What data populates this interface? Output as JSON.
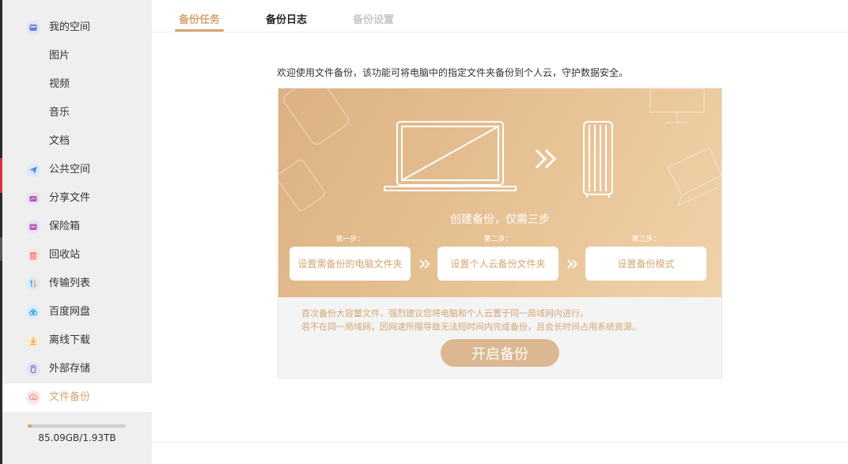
{
  "sidebar": {
    "items": [
      {
        "label": "我的空间",
        "icon": "my-space-icon",
        "color": "#6b7fd7"
      },
      {
        "label": "图片",
        "icon": ""
      },
      {
        "label": "视频",
        "icon": ""
      },
      {
        "label": "音乐",
        "icon": ""
      },
      {
        "label": "文档",
        "icon": ""
      },
      {
        "label": "公共空间",
        "icon": "paper-plane-icon",
        "color": "#4a90e2"
      },
      {
        "label": "分享文件",
        "icon": "share-icon",
        "color": "#9b59d6"
      },
      {
        "label": "保险箱",
        "icon": "safe-icon",
        "color": "#b05ad6"
      },
      {
        "label": "回收站",
        "icon": "trash-icon",
        "color": "#f06a5a"
      },
      {
        "label": "传输列表",
        "icon": "transfer-icon",
        "color": "#3aa3e3"
      },
      {
        "label": "百度网盘",
        "icon": "cloud-icon",
        "color": "#3aa3e3"
      },
      {
        "label": "离线下载",
        "icon": "download-icon",
        "color": "#f0a24a"
      },
      {
        "label": "外部存储",
        "icon": "usb-icon",
        "color": "#8e6ad6"
      },
      {
        "label": "文件备份",
        "icon": "backup-icon",
        "color": "#f08a8a"
      }
    ],
    "active_index": 13,
    "storage": {
      "text": "85.09GB/1.93TB",
      "used_fraction": 0.043
    }
  },
  "tabs": [
    "备份任务",
    "备份日志",
    "备份设置"
  ],
  "active_tab": 0,
  "intro": "欢迎使用文件备份，该功能可将电脑中的指定文件夹备份到个人云，守护数据安全。",
  "banner": {
    "title": "创建备份，仅需三步",
    "steps": [
      {
        "label": "第一步：",
        "text": "设置需备份的电脑文件夹"
      },
      {
        "label": "第二步：",
        "text": "设置个人云备份文件夹"
      },
      {
        "label": "第三步：",
        "text": "设置备份模式"
      }
    ]
  },
  "notes": [
    "首次备份大容量文件，强烈建议您将电脑和个人云置于同一局域网内进行。",
    "若不在同一局域网，因网速所限导致无法短时间内完成备份，且会长时间占用系统资源。"
  ],
  "start_button": "开启备份",
  "colors": {
    "accent": "#d4a574",
    "sidebar_bg": "#efefef"
  }
}
